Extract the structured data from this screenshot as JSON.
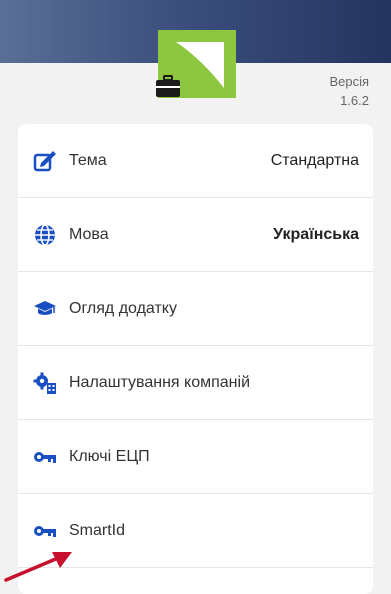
{
  "version": {
    "label": "Версія",
    "number": "1.6.2"
  },
  "colors": {
    "header_start": "#5a6e96",
    "header_end": "#24345f",
    "logo_green": "#8dc63f",
    "icon_blue": "#1a4fc4",
    "arrow_red": "#c8102e"
  },
  "settings": {
    "items": [
      {
        "label": "Тема",
        "value": "Стандартна",
        "icon": "theme-edit-icon"
      },
      {
        "label": "Мова",
        "value": "Українська",
        "icon": "globe-icon"
      },
      {
        "label": "Огляд додатку",
        "icon": "graduation-cap-icon"
      },
      {
        "label": "Налаштування компаній",
        "icon": "company-settings-icon"
      },
      {
        "label": "Ключі ЕЦП",
        "icon": "key-icon"
      },
      {
        "label": "SmartId",
        "icon": "key-icon"
      }
    ]
  }
}
